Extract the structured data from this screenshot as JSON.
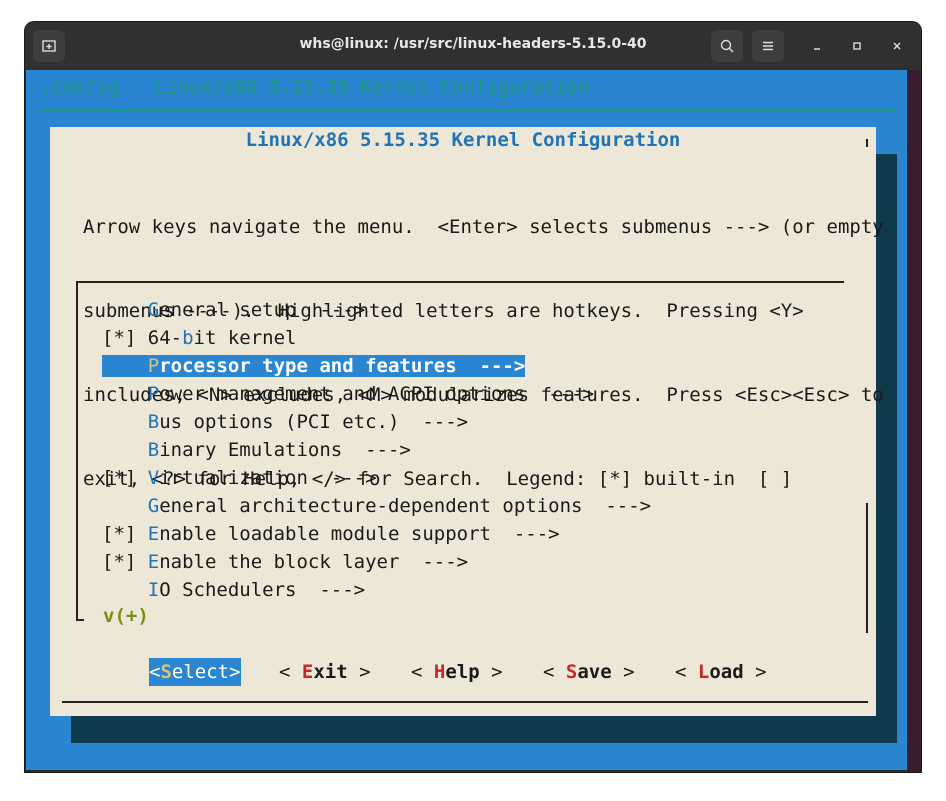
{
  "window": {
    "title": "whs@linux: /usr/src/linux-headers-5.15.0-40"
  },
  "terminal": {
    "config_line": ".config - Linux/x86 5.15.35 Kernel Configuration",
    "dialog_title": "Linux/x86 5.15.35 Kernel Configuration",
    "help_lines": [
      "Arrow keys navigate the menu.  <Enter> selects submenus ---> (or empty",
      "submenus ----).  Highlighted letters are hotkeys.  Pressing <Y>",
      "includes, <N> excludes, <M> modularizes features.  Press <Esc><Esc> to",
      "exit, <?> for Help, </> for Search.  Legend: [*] built-in  [ ]"
    ],
    "menu_items": [
      {
        "prefix": "    ",
        "hotkey": "G",
        "rest": "eneral setup  --->"
      },
      {
        "prefix": "[*] ",
        "pre": "64-",
        "hotkey": "b",
        "rest": "it kernel"
      },
      {
        "prefix": "    ",
        "hotkey": "P",
        "rest": "rocessor type and features  --->",
        "selected": true
      },
      {
        "prefix": "    ",
        "hotkey": "P",
        "rest": "ower management and ACPI options  --->"
      },
      {
        "prefix": "    ",
        "hotkey": "B",
        "rest": "us options (PCI etc.)  --->"
      },
      {
        "prefix": "    ",
        "hotkey": "B",
        "rest": "inary Emulations  --->"
      },
      {
        "prefix": "[*] ",
        "hotkey": "V",
        "rest": "irtualization  --->"
      },
      {
        "prefix": "    ",
        "hotkey": "G",
        "rest": "eneral architecture-dependent options  --->"
      },
      {
        "prefix": "[*] ",
        "hotkey": "E",
        "rest": "nable loadable module support  --->"
      },
      {
        "prefix": "[*] ",
        "hotkey": "E",
        "rest": "nable the block layer  --->"
      },
      {
        "prefix": "    ",
        "hotkey": "I",
        "rest": "O Schedulers  --->"
      }
    ],
    "more_indicator": "v(+)",
    "buttons": [
      {
        "open": "<",
        "hotkey": "S",
        "rest": "elect",
        "close": ">",
        "selected": true
      },
      {
        "open": "< ",
        "hotkey": "E",
        "rest": "xit",
        "close": " >"
      },
      {
        "open": "< ",
        "hotkey": "H",
        "rest": "elp",
        "close": " >"
      },
      {
        "open": "< ",
        "hotkey": "S",
        "rest": "ave",
        "close": " >"
      },
      {
        "open": "< ",
        "hotkey": "L",
        "rest": "oad",
        "close": " >"
      }
    ]
  },
  "icons": {
    "new_tab": "new-tab-icon",
    "search": "search-icon",
    "menu": "hamburger-menu-icon",
    "minimize": "minimize-icon",
    "maximize": "maximize-icon",
    "close": "close-icon"
  },
  "colors": {
    "terminal_bg": "#2a86d1",
    "dialog_bg": "#ece7d7",
    "hotkey": "#1f73b8",
    "button_hotkey": "#c62828",
    "config_text": "#1c9a7d",
    "more_indicator": "#7b9010"
  }
}
